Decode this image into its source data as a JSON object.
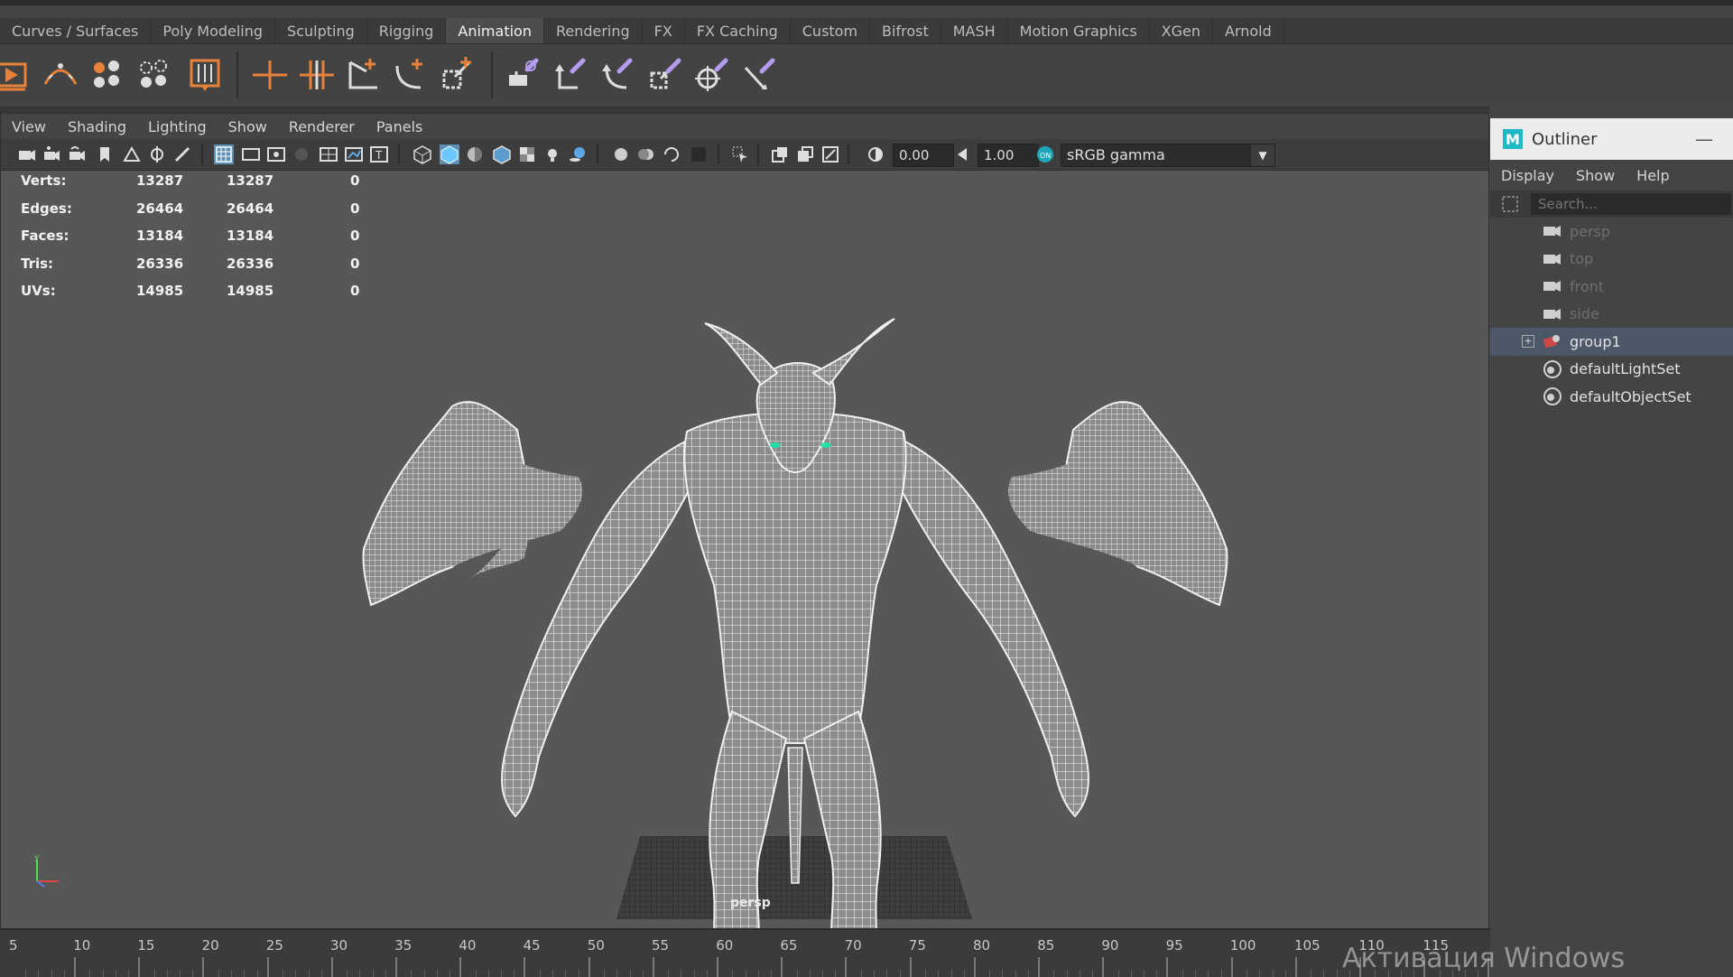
{
  "shelf": {
    "tabs": [
      {
        "label": "Curves / Surfaces",
        "active": false
      },
      {
        "label": "Poly Modeling",
        "active": false
      },
      {
        "label": "Sculpting",
        "active": false
      },
      {
        "label": "Rigging",
        "active": false
      },
      {
        "label": "Animation",
        "active": true
      },
      {
        "label": "Rendering",
        "active": false
      },
      {
        "label": "FX",
        "active": false
      },
      {
        "label": "FX Caching",
        "active": false
      },
      {
        "label": "Custom",
        "active": false
      },
      {
        "label": "Bifrost",
        "active": false
      },
      {
        "label": "MASH",
        "active": false
      },
      {
        "label": "Motion Graphics",
        "active": false
      },
      {
        "label": "XGen",
        "active": false
      },
      {
        "label": "Arnold",
        "active": false
      }
    ],
    "tools": [
      "playblast-icon",
      "motion-trail-icon",
      "ghost-icon",
      "unghost-icon",
      "bake-icon",
      "create-joint-icon",
      "insert-joint-icon",
      "ik-handle-icon",
      "ik-spline-icon",
      "scale-joint-icon",
      "parent-constraint-icon",
      "point-constraint-icon",
      "orient-constraint-icon",
      "scale-constraint-icon",
      "aim-constraint-icon",
      "pole-vector-icon"
    ]
  },
  "panel": {
    "menus": [
      "View",
      "Shading",
      "Lighting",
      "Show",
      "Renderer",
      "Panels"
    ],
    "exposure_value": "0.00",
    "gamma_value": "1.00",
    "colorspace": "sRGB gamma",
    "camera_label": "persp"
  },
  "hud": {
    "rows": [
      {
        "label": "Verts:",
        "c1": "13287",
        "c2": "13287",
        "c3": "0"
      },
      {
        "label": "Edges:",
        "c1": "26464",
        "c2": "26464",
        "c3": "0"
      },
      {
        "label": "Faces:",
        "c1": "13184",
        "c2": "13184",
        "c3": "0"
      },
      {
        "label": "Tris:",
        "c1": "26336",
        "c2": "26336",
        "c3": "0"
      },
      {
        "label": "UVs:",
        "c1": "14985",
        "c2": "14985",
        "c3": "0"
      }
    ]
  },
  "outliner": {
    "title": "Outliner",
    "menus": [
      "Display",
      "Show",
      "Help"
    ],
    "search_placeholder": "Search...",
    "items": [
      {
        "label": "persp",
        "icon": "camera-icon",
        "dim": true,
        "selected": false,
        "expandable": false
      },
      {
        "label": "top",
        "icon": "camera-icon",
        "dim": true,
        "selected": false,
        "expandable": false
      },
      {
        "label": "front",
        "icon": "camera-icon",
        "dim": true,
        "selected": false,
        "expandable": false
      },
      {
        "label": "side",
        "icon": "camera-icon",
        "dim": true,
        "selected": false,
        "expandable": false
      },
      {
        "label": "group1",
        "icon": "group-icon",
        "dim": false,
        "selected": true,
        "expandable": true
      },
      {
        "label": "defaultLightSet",
        "icon": "set-icon",
        "dim": false,
        "selected": false,
        "expandable": false
      },
      {
        "label": "defaultObjectSet",
        "icon": "set-icon",
        "dim": false,
        "selected": false,
        "expandable": false
      }
    ]
  },
  "timeline": {
    "labels": [
      "5",
      "10",
      "15",
      "20",
      "25",
      "30",
      "35",
      "40",
      "45",
      "50",
      "55",
      "60",
      "65",
      "70",
      "75",
      "80",
      "85",
      "90",
      "95",
      "100",
      "105",
      "110",
      "115"
    ]
  },
  "watermark": "Активация Windows",
  "colors": {
    "accent_selection": "#5e8fb5",
    "eye_glow": "#22e0a8",
    "tool_orange": "#e8823a",
    "tool_purple": "#b49cf0"
  }
}
